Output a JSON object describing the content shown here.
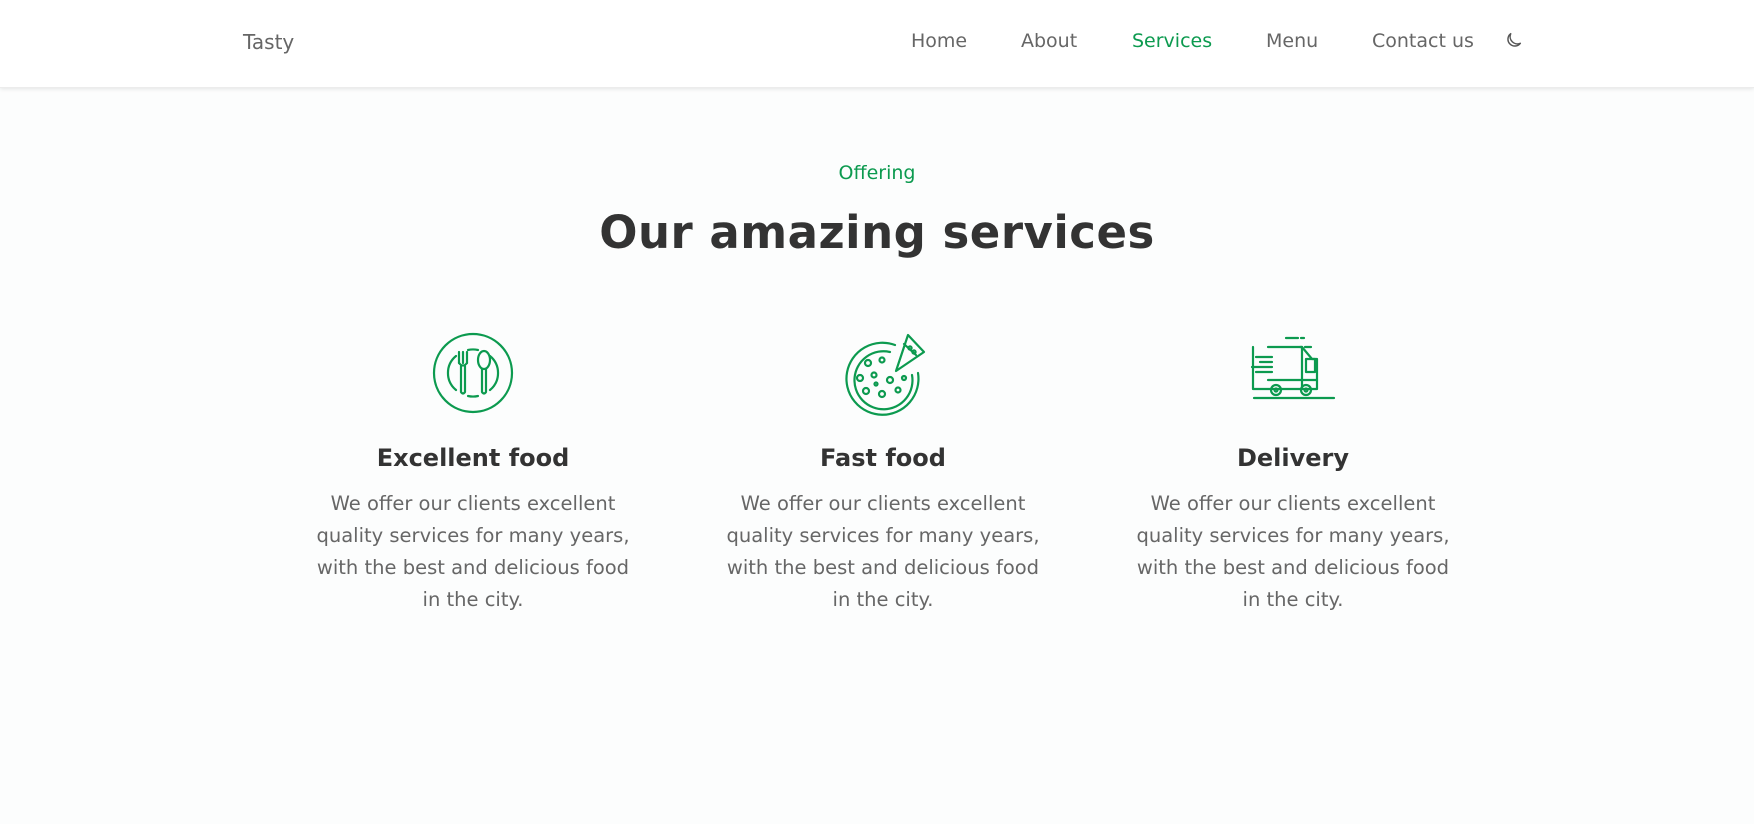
{
  "header": {
    "logo": "Tasty",
    "nav": [
      {
        "label": "Home",
        "active": false
      },
      {
        "label": "About",
        "active": false
      },
      {
        "label": "Services",
        "active": true
      },
      {
        "label": "Menu",
        "active": false
      },
      {
        "label": "Contact us",
        "active": false
      }
    ],
    "theme_icon": "moon-icon"
  },
  "section": {
    "subtitle": "Offering",
    "title": "Our amazing services"
  },
  "services": [
    {
      "icon": "cutlery-plate-icon",
      "title": "Excellent food",
      "description": "We offer our clients excellent quality services for many years, with the best and delicious food in the city."
    },
    {
      "icon": "pizza-icon",
      "title": "Fast food",
      "description": "We offer our clients excellent quality services for many years, with the best and delicious food in the city."
    },
    {
      "icon": "delivery-truck-icon",
      "title": "Delivery",
      "description": "We offer our clients excellent quality services for many years, with the best and delicious food in the city."
    }
  ],
  "colors": {
    "accent": "#0c9a4f",
    "heading": "#333333",
    "text": "#666666",
    "background": "#fcfdfd"
  }
}
